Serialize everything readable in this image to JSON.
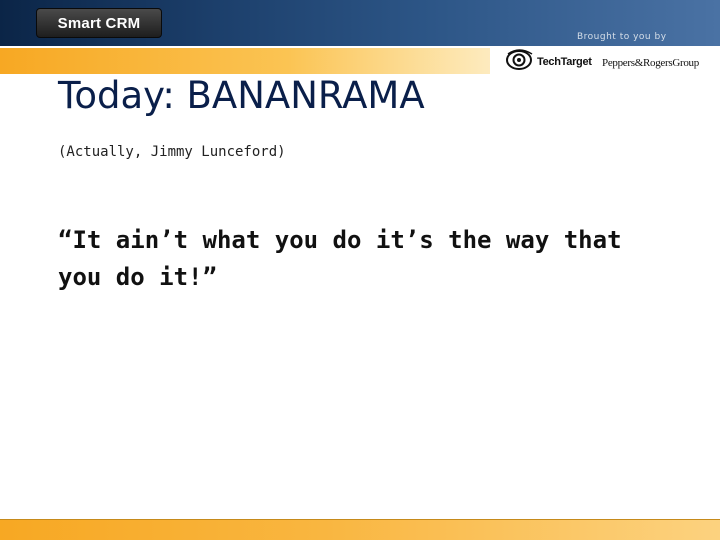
{
  "header": {
    "logo_text": "Smart CRM",
    "brought_by": "Brought to you by"
  },
  "sponsors": {
    "techtarget": "TechTarget",
    "peppers": "Peppers&RogersGroup",
    "eye_icon": "eye-icon"
  },
  "slide": {
    "title": "Today: BANANRAMA",
    "subtitle": "(Actually, Jimmy Lunceford)",
    "quote": "“It ain’t what you do it’s the way that you do it!”"
  },
  "colors": {
    "header_dark": "#0b2547",
    "header_light": "#4a72a4",
    "accent_orange": "#f7a823",
    "title_color": "#0a1f4a"
  }
}
